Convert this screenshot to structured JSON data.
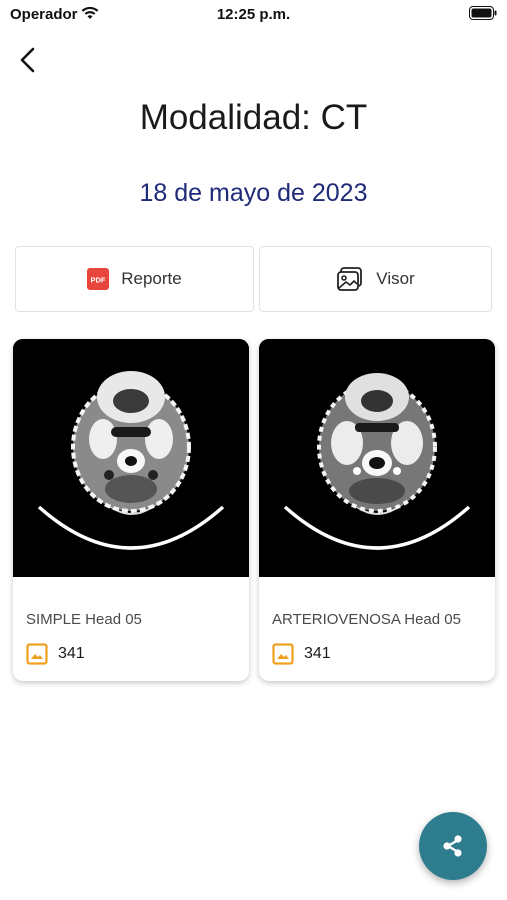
{
  "status_bar": {
    "carrier": "Operador",
    "time": "12:25 p.m."
  },
  "header": {
    "title": "Modalidad: CT",
    "date": "18 de mayo de 2023"
  },
  "actions": {
    "report_label": "Reporte",
    "viewer_label": "Visor",
    "pdf_badge": "PDF"
  },
  "series": [
    {
      "title": "SIMPLE Head 05",
      "image_count": "341"
    },
    {
      "title": "ARTERIOVENOSA Head 05",
      "image_count": "341"
    }
  ],
  "colors": {
    "date": "#1f2a78",
    "fab": "#2e7d8e",
    "pdf_badge": "#e8453c",
    "image_icon": "#f0a020"
  },
  "icons": [
    "wifi-icon",
    "battery-icon",
    "back-icon",
    "pdf-icon",
    "gallery-icon",
    "image-icon",
    "share-icon"
  ]
}
